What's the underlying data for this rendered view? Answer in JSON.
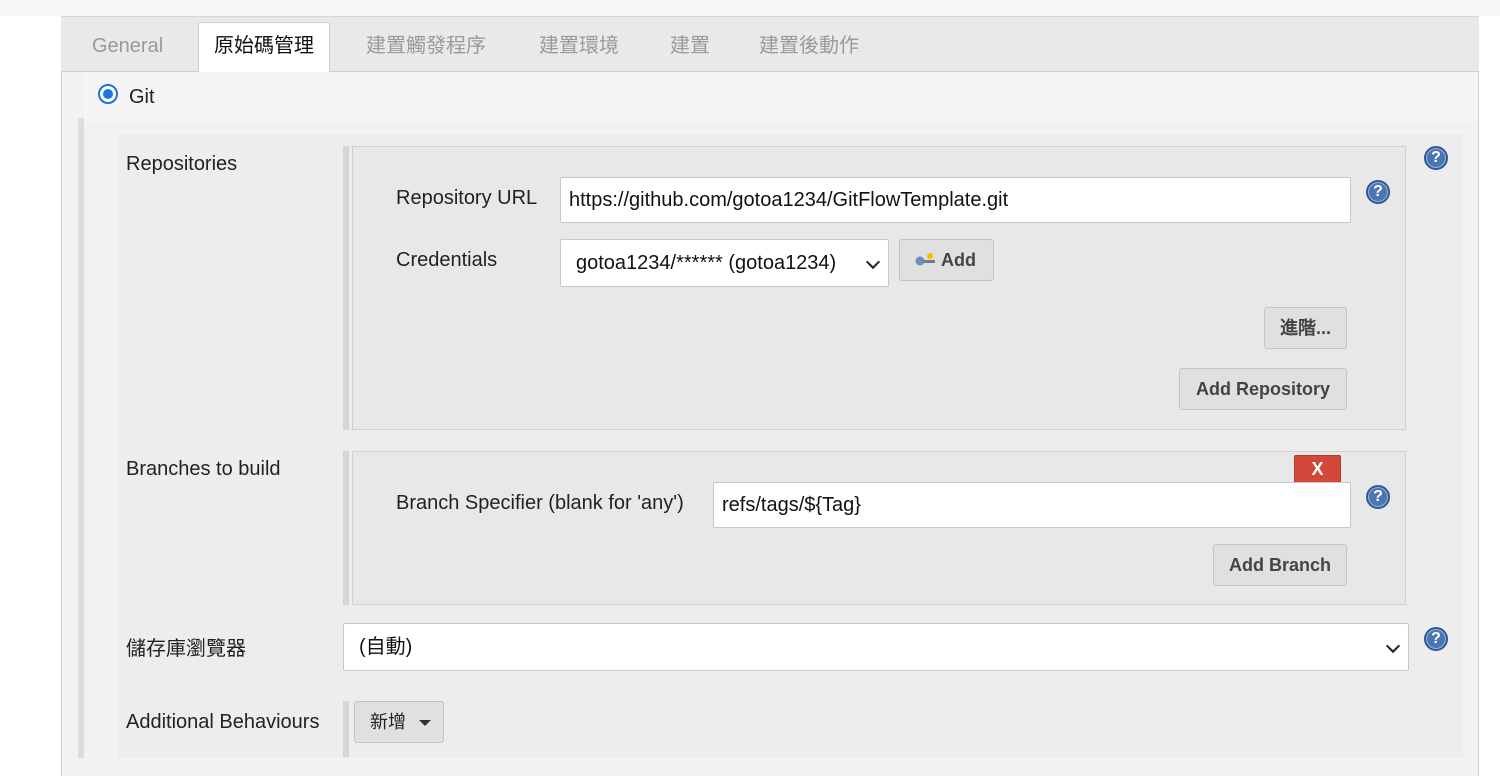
{
  "tabs": [
    "General",
    "原始碼管理",
    "建置觸發程序",
    "建置環境",
    "建置",
    "建置後動作"
  ],
  "scm": {
    "git_label": "Git",
    "selected": true
  },
  "repositories": {
    "label": "Repositories",
    "url_label": "Repository URL",
    "url_value": "https://github.com/gotoa1234/GitFlowTemplate.git",
    "credentials_label": "Credentials",
    "credentials_value": "gotoa1234/****** (gotoa1234)",
    "add_label": "Add",
    "advanced_label": "進階...",
    "add_repository_label": "Add Repository"
  },
  "branches": {
    "label": "Branches to build",
    "delete_label": "X",
    "specifier_label": "Branch Specifier (blank for 'any')",
    "specifier_value": "refs/tags/${Tag}",
    "add_branch_label": "Add Branch"
  },
  "repo_browser": {
    "label": "儲存庫瀏覽器",
    "value": "(自動)"
  },
  "behaviours": {
    "label": "Additional Behaviours",
    "add_label": "新增"
  },
  "help_glyph": "?",
  "colors": {
    "accent": "#1a73e8",
    "help": "#4b76b2",
    "danger": "#d24939"
  }
}
